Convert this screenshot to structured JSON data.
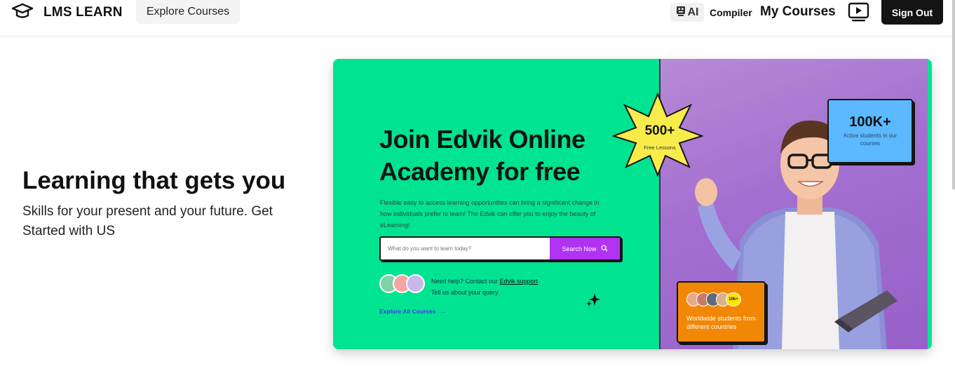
{
  "header": {
    "brand_name": "LMS LEARN",
    "explore_courses": "Explore Courses",
    "ai_label": "AI",
    "compiler_label": "Compiler",
    "my_courses": "My Courses",
    "sign_out": "Sign Out"
  },
  "hero": {
    "title": "Learning that gets you",
    "subtitle": "Skills for your present and your future. Get Started with US"
  },
  "banner": {
    "title": "Join Edvik Online Academy for free",
    "description": "Flexible easy to access learning opportunities can bring a significant change in how individuals prefer to learn! The Edvik can offer you to enjoy the beauty of eLearning!",
    "search_placeholder": "What do you want to learn today?",
    "search_button": "Search Now",
    "help_prefix": "Need help? Contact our",
    "help_link": "Edvik support",
    "help_line2": "Tell us about your query.",
    "explore_all": "Explore All Courses",
    "lessons_count": "500+",
    "lessons_label": "Free Lessons",
    "students_count": "100K+",
    "students_label": "Active students in our courses",
    "worldwide_badge": "10k+",
    "worldwide_label": "Worldwide students from different countries"
  },
  "colors": {
    "green": "#00e491",
    "purple": "#a36fd0",
    "search_button": "#b133f2",
    "blue_card": "#5cb8ff",
    "orange_card": "#f28705",
    "star": "#f7ec4a"
  }
}
